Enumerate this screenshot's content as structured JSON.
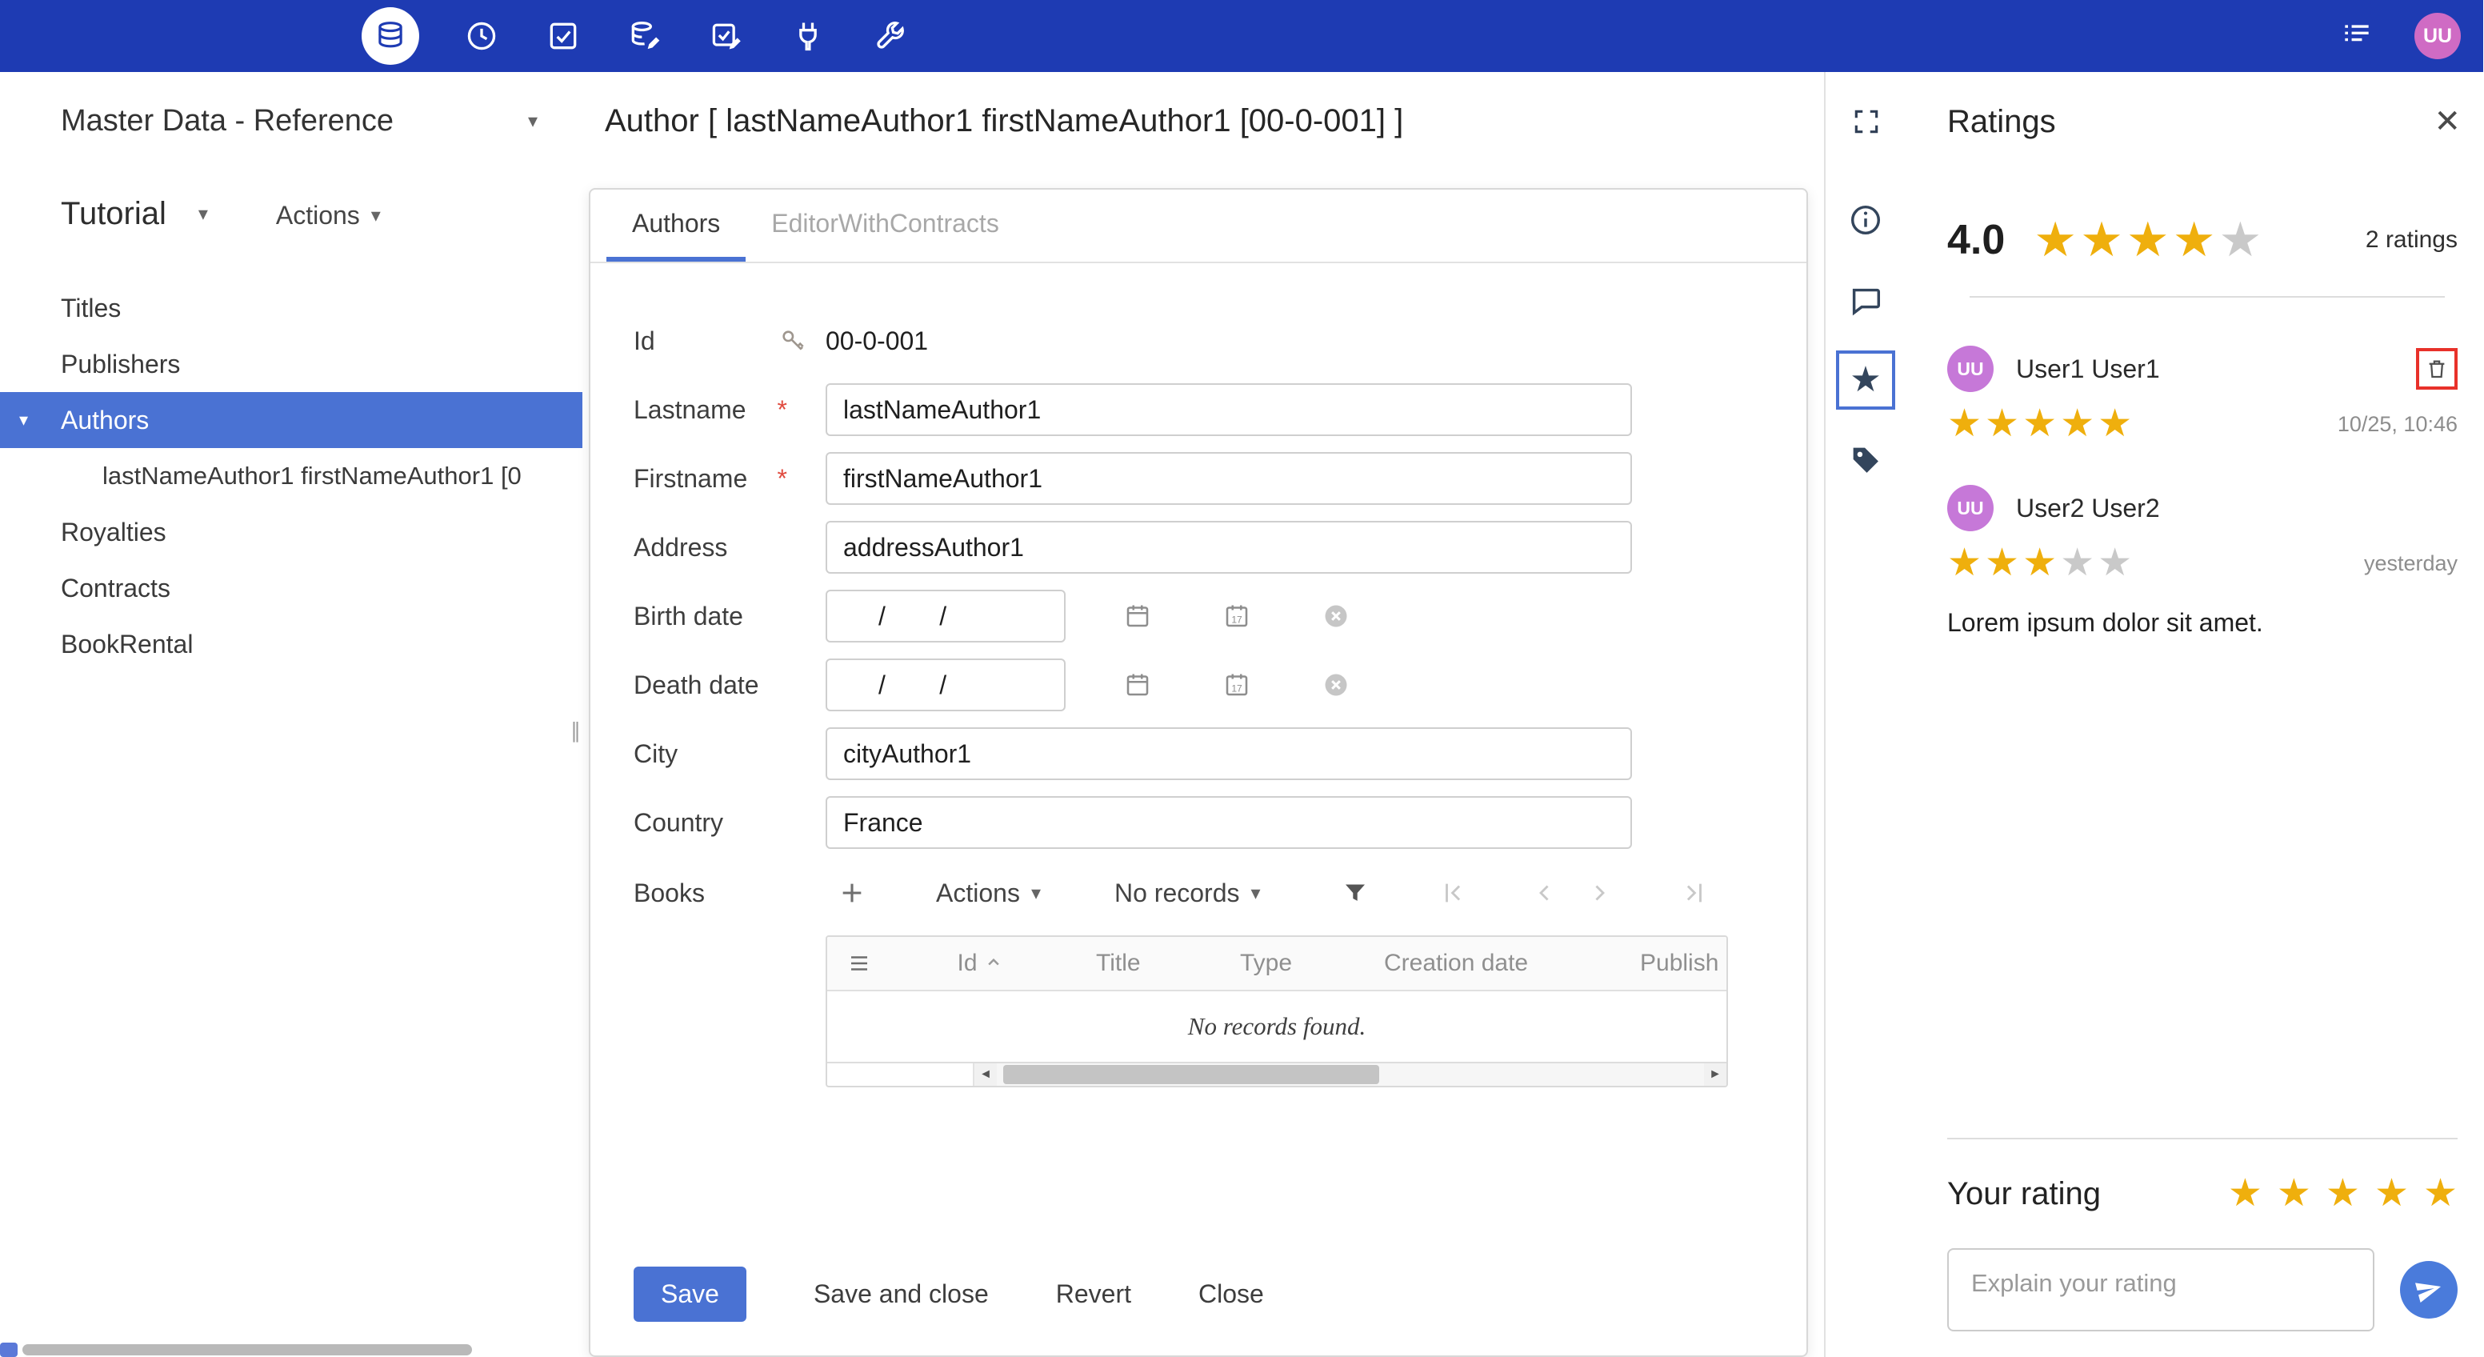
{
  "topbar": {
    "avatar_initials": "UU"
  },
  "sidebar": {
    "app_menu_label": "Master Data - Reference",
    "workspace_label": "Tutorial",
    "actions_label": "Actions",
    "items": [
      {
        "label": "Titles"
      },
      {
        "label": "Publishers"
      },
      {
        "label": "Authors"
      },
      {
        "label": "lastNameAuthor1 firstNameAuthor1 [0"
      },
      {
        "label": "Royalties"
      },
      {
        "label": "Contracts"
      },
      {
        "label": "BookRental"
      }
    ]
  },
  "editor": {
    "title": "Author [ lastNameAuthor1 firstNameAuthor1 [00-0-001] ]",
    "tabs": [
      {
        "label": "Authors"
      },
      {
        "label": "EditorWithContracts"
      }
    ],
    "fields": {
      "id": {
        "label": "Id",
        "value": "00-0-001"
      },
      "lastname": {
        "label": "Lastname",
        "required_mark": "*",
        "value": "lastNameAuthor1"
      },
      "firstname": {
        "label": "Firstname",
        "required_mark": "*",
        "value": "firstNameAuthor1"
      },
      "address": {
        "label": "Address",
        "value": "addressAuthor1"
      },
      "birth_date": {
        "label": "Birth date",
        "value": "/      /"
      },
      "death_date": {
        "label": "Death date",
        "value": "/      /"
      },
      "city": {
        "label": "City",
        "value": "cityAuthor1"
      },
      "country": {
        "label": "Country",
        "value": "France"
      }
    },
    "books": {
      "label": "Books",
      "actions_label": "Actions",
      "pager_label": "No records",
      "columns": [
        "Id",
        "Title",
        "Type",
        "Creation date",
        "Publish"
      ],
      "empty_message": "No records found."
    },
    "buttons": {
      "save": "Save",
      "save_and_close": "Save and close",
      "revert": "Revert",
      "close": "Close"
    }
  },
  "ratings": {
    "panel_title": "Ratings",
    "average": "4.0",
    "average_stars": 4,
    "count_label": "2 ratings",
    "reviews": [
      {
        "avatar_initials": "UU",
        "name": "User1 User1",
        "stars": 5,
        "timestamp": "10/25, 10:46"
      },
      {
        "avatar_initials": "UU",
        "name": "User2 User2",
        "stars": 3,
        "timestamp": "yesterday",
        "comment": "Lorem ipsum dolor sit amet."
      }
    ],
    "your_rating_label": "Your rating",
    "your_rating_stars": 5,
    "comment_placeholder": "Explain your rating"
  }
}
